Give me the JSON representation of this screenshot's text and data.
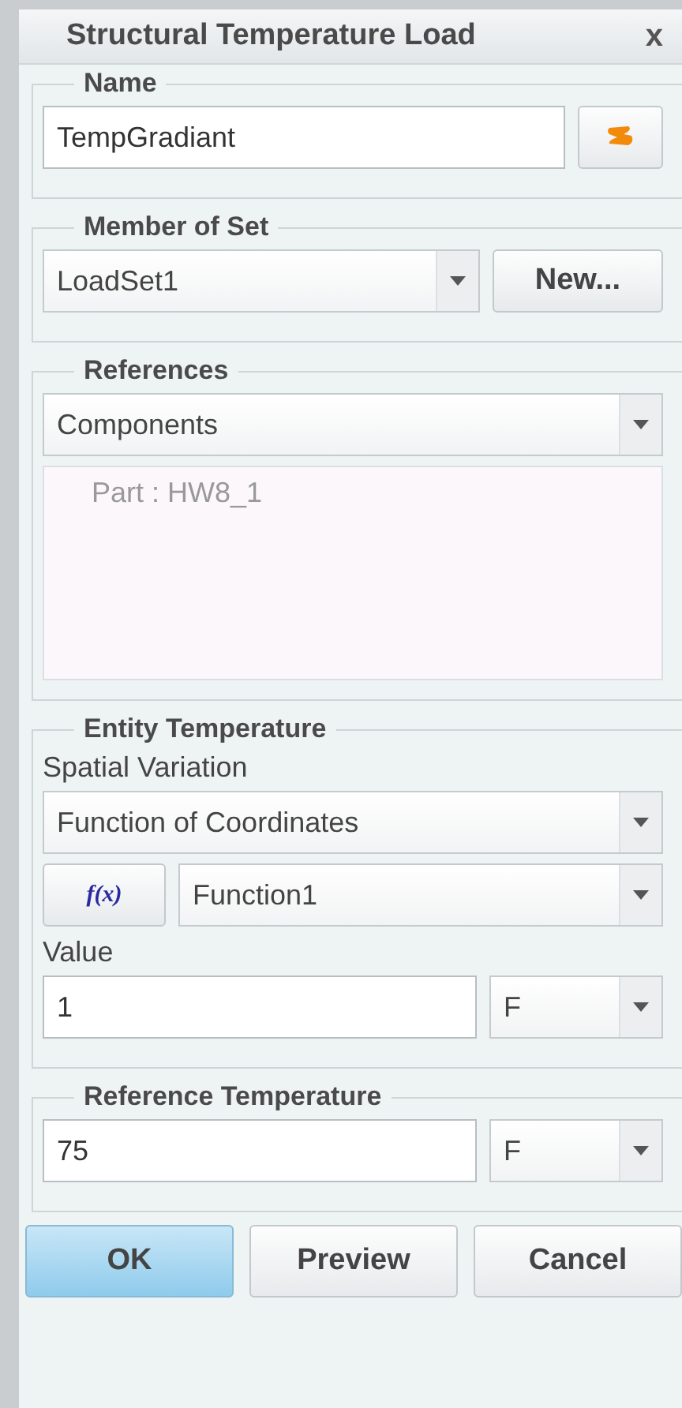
{
  "window": {
    "title": "Structural Temperature Load",
    "close": "x"
  },
  "name": {
    "legend": "Name",
    "value": "TempGradiant"
  },
  "member_of_set": {
    "legend": "Member of Set",
    "value": "LoadSet1",
    "button": "New..."
  },
  "references": {
    "legend": "References",
    "type": "Components",
    "items": [
      "Part : HW8_1"
    ]
  },
  "entity_temperature": {
    "legend": "Entity Temperature",
    "spatial_label": "Spatial Variation",
    "spatial": "Function of Coordinates",
    "function_button": "f(x)",
    "function": "Function1",
    "value_label": "Value",
    "value": "1",
    "unit": "F"
  },
  "reference_temperature": {
    "legend": "Reference Temperature",
    "value": "75",
    "unit": "F"
  },
  "buttons": [
    {
      "label": "OK",
      "default": true
    },
    {
      "label": "Preview",
      "default": false
    },
    {
      "label": "Cancel",
      "default": false
    }
  ]
}
